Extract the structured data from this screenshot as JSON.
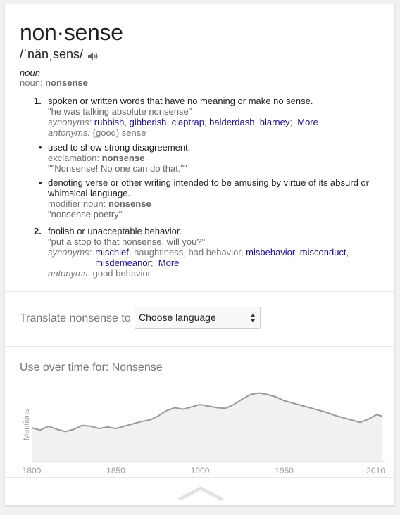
{
  "entry": {
    "headword": "non·sense",
    "pronunciation": "/ˈnänˌsens/",
    "speaker_icon": "speaker-icon",
    "part_of_speech": "noun",
    "noun_label_prefix": "noun:",
    "noun_label_word": "nonsense"
  },
  "senses": {
    "s1": {
      "number": "1.",
      "definition": "spoken or written words that have no meaning or make no sense.",
      "example": "\"he was talking absolute nonsense\"",
      "synonyms_label": "synonyms:",
      "synonyms": [
        "rubbish",
        "gibberish",
        "claptrap",
        "balderdash",
        "blarney"
      ],
      "more_label": "More",
      "antonyms_label": "antonyms:",
      "antonyms": "(good) sense"
    },
    "b1": {
      "bullet": "•",
      "definition": "used to show strong disagreement.",
      "label_prefix": "exclamation:",
      "label_word": "nonsense",
      "example": "\"\"Nonsense! No one can do that.\"\""
    },
    "b2": {
      "bullet": "•",
      "definition_line1": "denoting verse or other writing intended to be amusing by virtue of its absurd or",
      "definition_line2": "whimsical language.",
      "label_prefix": "modifier noun:",
      "label_word": "nonsense",
      "example": "\"nonsense poetry\""
    },
    "s2": {
      "number": "2.",
      "definition": "foolish or unacceptable behavior.",
      "example": "\"put a stop to that nonsense, will you?\"",
      "synonyms_label": "synonyms:",
      "syn_a": "mischief",
      "syn_b": "naughtiness",
      "syn_c": "bad behavior",
      "syn_d": "misbehavior",
      "syn_e": "misconduct",
      "syn_f": "misdemeanor",
      "more_label": "More",
      "antonyms_label": "antonyms:",
      "antonyms": "good behavior"
    }
  },
  "translate": {
    "label": "Translate nonsense to",
    "select_value": "Choose language"
  },
  "usage": {
    "title": "Use over time for: Nonsense",
    "collapse_icon": "chevron-up-icon"
  },
  "chart_data": {
    "type": "area",
    "title": "Use over time for: Nonsense",
    "ylabel": "Mentions",
    "xlabel": "",
    "xlim": [
      1800,
      2010
    ],
    "x_ticks": [
      "1800",
      "1850",
      "1900",
      "1950",
      "2010"
    ],
    "x": [
      1800,
      1805,
      1810,
      1815,
      1820,
      1825,
      1830,
      1835,
      1840,
      1845,
      1850,
      1855,
      1860,
      1865,
      1870,
      1875,
      1880,
      1885,
      1890,
      1895,
      1900,
      1905,
      1910,
      1915,
      1920,
      1925,
      1930,
      1935,
      1940,
      1945,
      1950,
      1955,
      1960,
      1965,
      1970,
      1975,
      1980,
      1985,
      1990,
      1995,
      2000,
      2005,
      2008
    ],
    "y": [
      0.4,
      0.37,
      0.42,
      0.38,
      0.35,
      0.38,
      0.43,
      0.42,
      0.39,
      0.41,
      0.39,
      0.42,
      0.45,
      0.48,
      0.5,
      0.55,
      0.62,
      0.66,
      0.64,
      0.67,
      0.7,
      0.68,
      0.66,
      0.65,
      0.7,
      0.77,
      0.83,
      0.85,
      0.83,
      0.8,
      0.75,
      0.72,
      0.69,
      0.66,
      0.63,
      0.6,
      0.56,
      0.53,
      0.5,
      0.47,
      0.51,
      0.57,
      0.55
    ],
    "grid": false,
    "legend": "none",
    "colors": {
      "line": "#9a9a9a",
      "fill": "#f1f1f1"
    }
  }
}
